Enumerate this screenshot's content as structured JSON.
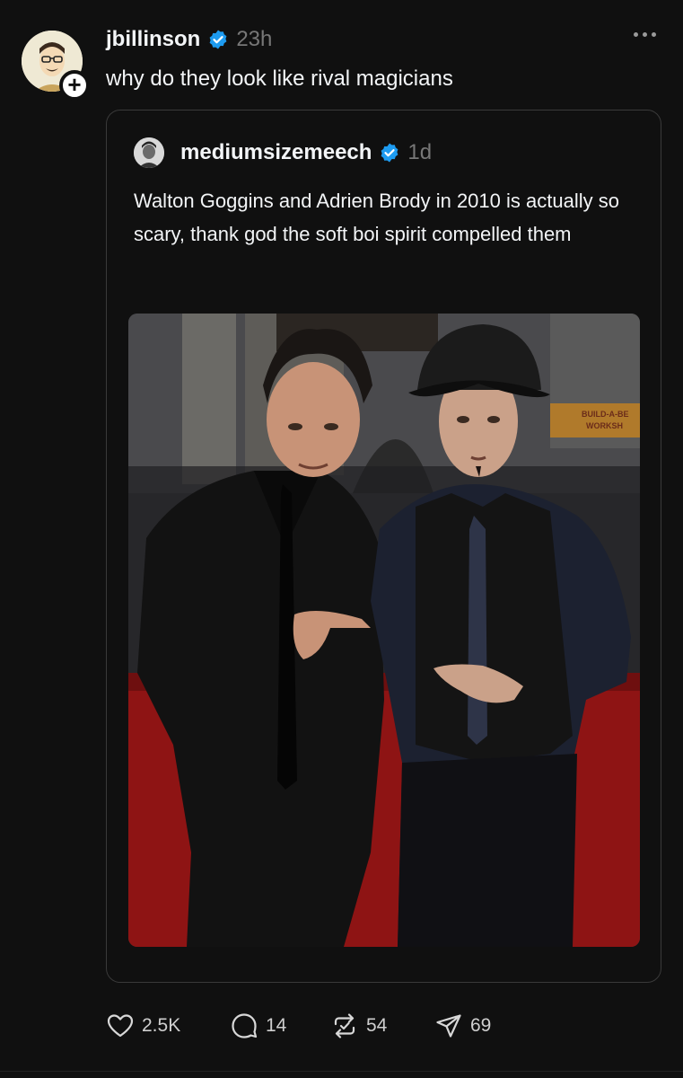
{
  "post": {
    "author": {
      "username": "jbillinson",
      "verified": true,
      "avatar": "avatar"
    },
    "timestamp": "23h",
    "follow_badge": "+",
    "text": "why do they look like rival magicians",
    "more_icon": "more-horizontal-icon"
  },
  "quoted_post": {
    "author": {
      "username": "mediumsizemeech",
      "verified": true,
      "avatar": "avatar"
    },
    "timestamp": "1d",
    "text": "Walton Goggins and Adrien Brody in 2010 is actually so scary, thank god the soft boi spirit compelled them",
    "image": {
      "alt_visible": false,
      "poster_text_left": "BUILD-A-BE",
      "poster_text_left2": "WORKSH",
      "colors": {
        "carpet": "#8e1414",
        "background": "#3a3a3a"
      }
    }
  },
  "actions": {
    "like": {
      "icon": "heart-icon",
      "count": "2.5K"
    },
    "reply": {
      "icon": "comment-icon",
      "count": "14"
    },
    "repost": {
      "icon": "repost-icon",
      "count": "54"
    },
    "share": {
      "icon": "send-icon",
      "count": "69"
    }
  },
  "colors": {
    "background": "#101010",
    "text": "#f3f5f7",
    "muted": "#777777",
    "verified": "#1d9bf0",
    "border": "#3a3a3a"
  }
}
